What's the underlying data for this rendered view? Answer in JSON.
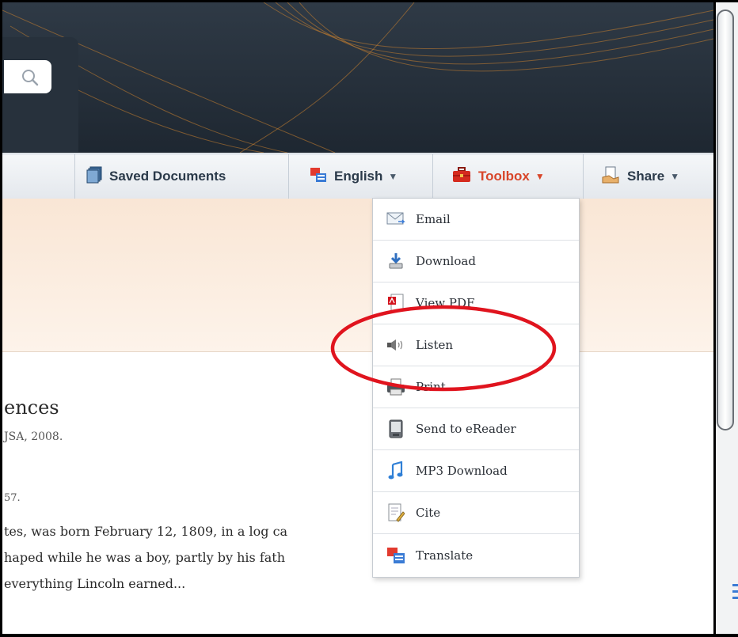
{
  "toolbar": {
    "saved_documents": "Saved Documents",
    "language": "English",
    "toolbox": "Toolbox",
    "share": "Share",
    "caret": "▼"
  },
  "toolbox_menu": [
    {
      "label": "Email",
      "icon": "email-icon"
    },
    {
      "label": "Download",
      "icon": "download-icon"
    },
    {
      "label": "View PDF",
      "icon": "pdf-icon"
    },
    {
      "label": "Listen",
      "icon": "speaker-icon"
    },
    {
      "label": "Print",
      "icon": "printer-icon"
    },
    {
      "label": "Send to eReader",
      "icon": "ereader-icon"
    },
    {
      "label": "MP3 Download",
      "icon": "music-note-icon"
    },
    {
      "label": "Cite",
      "icon": "cite-icon"
    },
    {
      "label": "Translate",
      "icon": "translate-icon"
    }
  ],
  "article": {
    "title_fragment": "ences",
    "source_fragment": "JSA, 2008.",
    "ref_fragment": "57.",
    "lines": [
      "tes, was born February 12, 1809, in a log ca",
      "haped while he was a boy, partly by his fath",
      "everything Lincoln earned..."
    ]
  },
  "colors": {
    "banner": "#1e2731",
    "accent_orange": "#d8462a",
    "annotation_red": "#e0141e",
    "peach": "#f9e6d5"
  }
}
